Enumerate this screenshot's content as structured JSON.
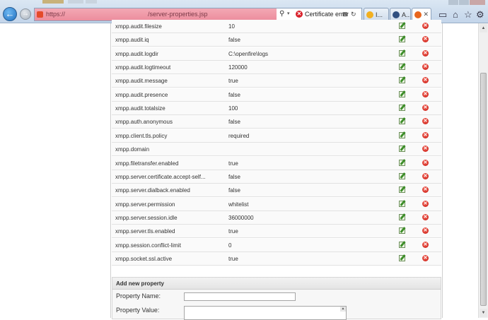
{
  "browser": {
    "address_host": "https://",
    "address_path": "/server-properties.jsp",
    "certificate_error": "Certificate error",
    "address_misc": "⊠ ↻ ✕",
    "tabs": [
      {
        "label": "I...",
        "close": ""
      },
      {
        "label": "A...",
        "close": ""
      },
      {
        "label": "",
        "close": "✕"
      }
    ],
    "icons": [
      "home-icon",
      "favorites-star-icon",
      "settings-gear-icon"
    ]
  },
  "properties": [
    {
      "name": "xmpp.audit.filesize",
      "value": "10"
    },
    {
      "name": "xmpp.audit.iq",
      "value": "false"
    },
    {
      "name": "xmpp.audit.logdir",
      "value": "C:\\openfire\\logs"
    },
    {
      "name": "xmpp.audit.logtimeout",
      "value": "120000"
    },
    {
      "name": "xmpp.audit.message",
      "value": "true"
    },
    {
      "name": "xmpp.audit.presence",
      "value": "false"
    },
    {
      "name": "xmpp.audit.totalsize",
      "value": "100"
    },
    {
      "name": "xmpp.auth.anonymous",
      "value": "false"
    },
    {
      "name": "xmpp.client.tls.policy",
      "value": "required"
    },
    {
      "name": "xmpp.domain",
      "value": ""
    },
    {
      "name": "xmpp.filetransfer.enabled",
      "value": "true"
    },
    {
      "name": "xmpp.server.certificate.accept-self...",
      "value": "false"
    },
    {
      "name": "xmpp.server.dialback.enabled",
      "value": "false"
    },
    {
      "name": "xmpp.server.permission",
      "value": "whitelist"
    },
    {
      "name": "xmpp.server.session.idle",
      "value": "36000000"
    },
    {
      "name": "xmpp.server.tls.enabled",
      "value": "true"
    },
    {
      "name": "xmpp.session.conflict-limit",
      "value": "0"
    },
    {
      "name": "xmpp.socket.ssl.active",
      "value": "true"
    }
  ],
  "add_property": {
    "title": "Add new property",
    "name_label": "Property Name:",
    "value_label": "Property Value:",
    "name_value": "",
    "value_value": ""
  }
}
